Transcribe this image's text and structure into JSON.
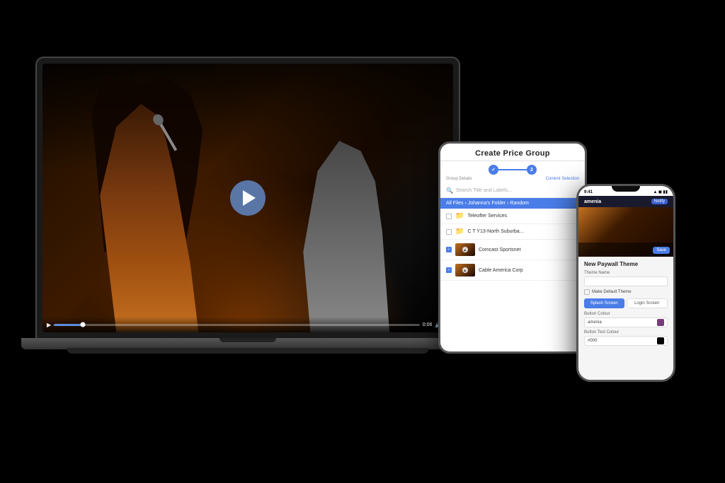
{
  "scene": {
    "bg_color": "#000000"
  },
  "laptop": {
    "label": "laptop-device",
    "play_button": "▶",
    "time_current": "0:06",
    "video_controls": {
      "play": "▶",
      "time": "0:06",
      "volume": "🔊",
      "fullscreen": "⛶"
    }
  },
  "tablet": {
    "label": "tablet-device",
    "title": "Create Price Group",
    "step1_label": "Group Details",
    "step2_label": "Content Selection",
    "search_placeholder": "Search Title and Labels...",
    "breadcrumb": "All Files › Johanna's Folder › Random",
    "files": [
      {
        "name": "Teleofter Services",
        "type": "folder",
        "checked": false
      },
      {
        "name": "C T Y13-North Suburba...",
        "type": "folder",
        "checked": false
      },
      {
        "name": "Comcast Sportsnet",
        "type": "video",
        "checked": true
      },
      {
        "name": "Cable America Corp",
        "type": "video",
        "checked": true
      }
    ]
  },
  "phone": {
    "label": "phone-device",
    "time": "9:41",
    "icons": "▲ ◼ ▮▮",
    "header_text": "amenia",
    "notify_btn": "Notify",
    "section_title": "New Paywall Theme",
    "fields": [
      {
        "label": "Theme Name",
        "value": ""
      },
      {
        "label": "Make Default Theme",
        "type": "checkbox"
      },
      {
        "label": "Button Colour",
        "value": "amenia"
      },
      {
        "label": "Button Text Colour",
        "value": "#000"
      }
    ],
    "tabs": [
      {
        "label": "Splash Screen",
        "active": true
      },
      {
        "label": "Login Screen",
        "active": false
      }
    ]
  }
}
